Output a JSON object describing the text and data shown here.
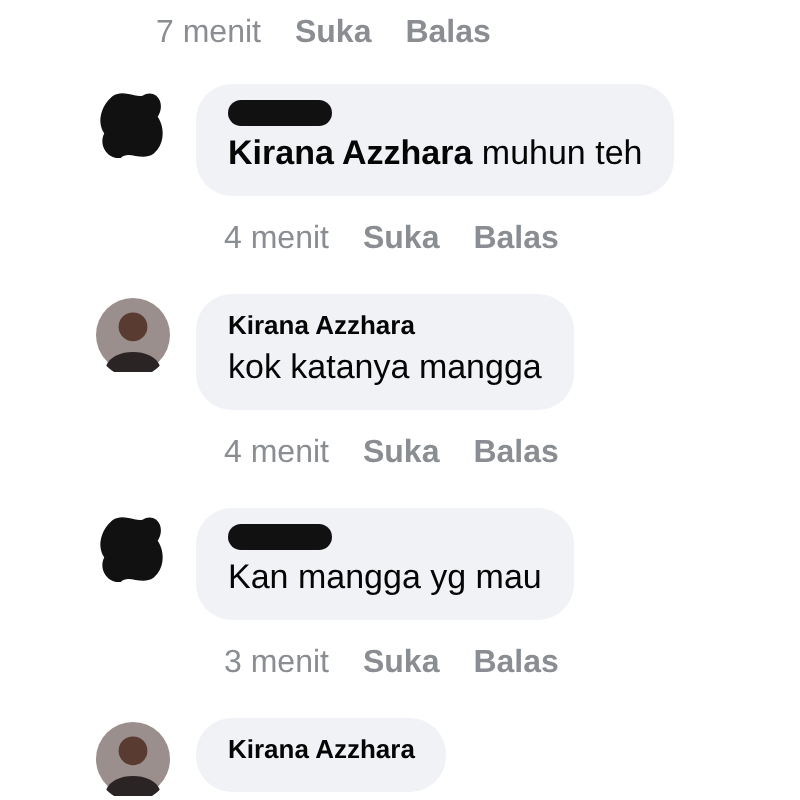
{
  "previous_meta": {
    "time": "7 menit",
    "like": "Suka",
    "reply": "Balas"
  },
  "comments": [
    {
      "avatar_redacted": true,
      "name_redacted": true,
      "text": "**Kirana Azzhara** muhun teh",
      "meta": {
        "time": "4 menit",
        "like": "Suka",
        "reply": "Balas"
      }
    },
    {
      "avatar_redacted": false,
      "name": "Kirana Azzhara",
      "text": "kok katanya mangga",
      "meta": {
        "time": "4 menit",
        "like": "Suka",
        "reply": "Balas"
      }
    },
    {
      "avatar_redacted": true,
      "name_redacted": true,
      "text": "Kan mangga yg mau",
      "meta": {
        "time": "3 menit",
        "like": "Suka",
        "reply": "Balas"
      }
    },
    {
      "avatar_redacted": false,
      "name": "Kirana Azzhara"
    }
  ]
}
